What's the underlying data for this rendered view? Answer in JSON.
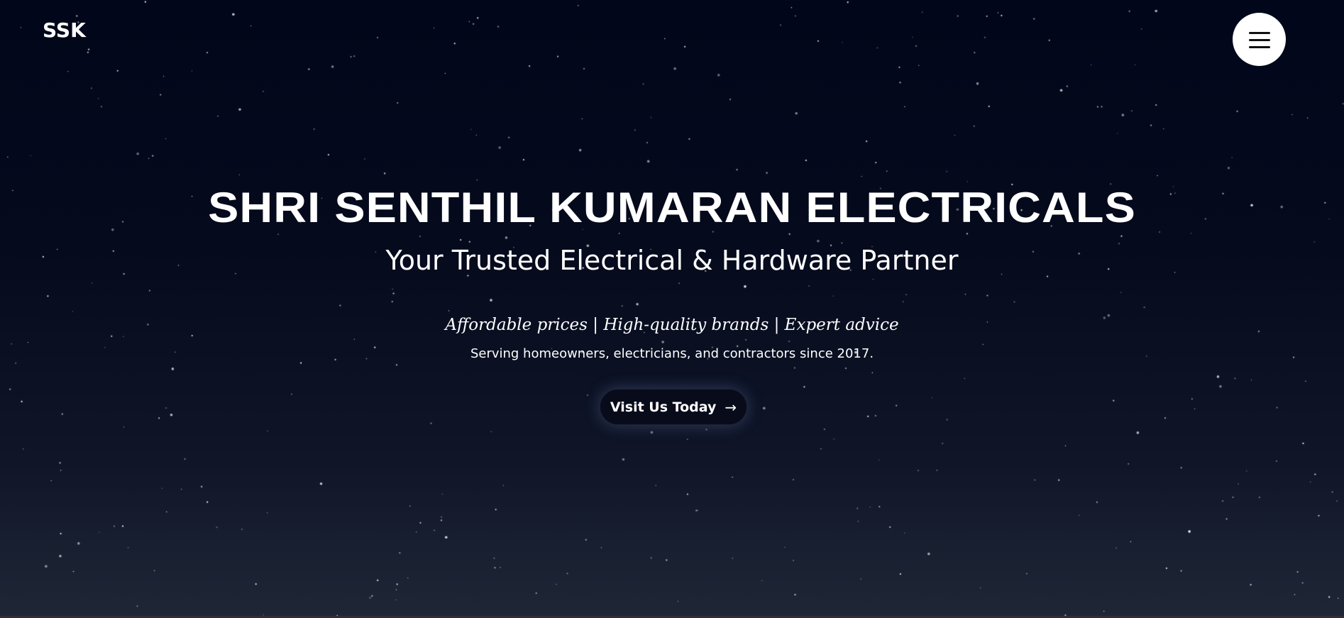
{
  "header": {
    "logo": "SSK",
    "menu_icon": "hamburger-menu-icon"
  },
  "hero": {
    "title": "SHRI SENTHIL KUMARAN ELECTRICALS",
    "subtitle": "Your Trusted Electrical & Hardware Partner",
    "tagline": "Affordable prices | High-quality brands | Expert advice",
    "description": "Serving homeowners, electricians, and contractors since 2017.",
    "cta_label": "Visit Us Today",
    "cta_icon": "arrow-right-icon",
    "cta_arrow": "→"
  },
  "colors": {
    "background_top": "#02061a",
    "background_bottom": "#1f2737",
    "text": "#ffffff",
    "menu_button_bg": "#ffffff",
    "cta_bg": "#070b1a"
  }
}
